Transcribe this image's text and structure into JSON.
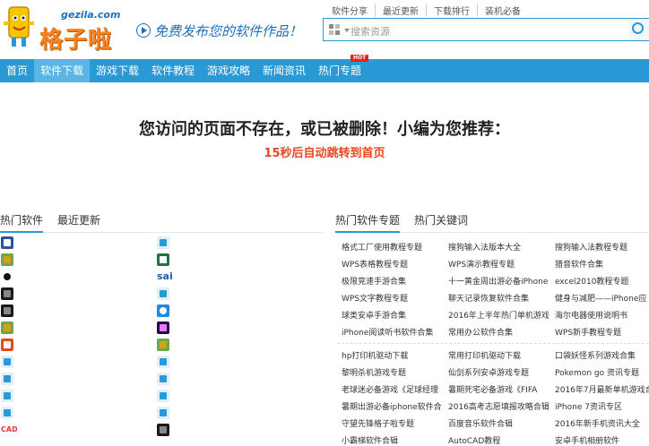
{
  "header": {
    "site_url": "gezila.com",
    "brand": "格子啦",
    "slogan": "免费发布您的软件作品！",
    "top_links": [
      "软件分享",
      "最近更新",
      "下载排行",
      "装机必备"
    ],
    "search_placeholder": "搜索资源"
  },
  "nav": {
    "items": [
      "首页",
      "软件下载",
      "游戏下载",
      "软件教程",
      "游戏攻略",
      "新闻资讯",
      "热门专题"
    ],
    "active_index": 1,
    "hot_badge": "HOT"
  },
  "notice": {
    "message": "您访问的页面不存在，或已被删除！小编为您推荐：",
    "redirect": "15秒后自动跳转到首页"
  },
  "left_panel": {
    "tabs": [
      "热门软件",
      "最近更新"
    ],
    "active_tab": 0,
    "left_column_icons": [
      "word-icon",
      "game-icon",
      "qq-icon",
      "film-icon",
      "film-icon",
      "game-icon",
      "office-icon",
      "app-icon",
      "app-icon",
      "app-icon",
      "app-icon",
      "cad-icon"
    ],
    "right_column_icons": [
      "app-icon",
      "excel-icon",
      "sai-icon",
      "app-icon",
      "refresh-icon",
      "premiere-icon",
      "game-icon",
      "app-icon",
      "app-icon",
      "app-icon",
      "app-icon",
      "film-icon"
    ],
    "sai_label": "sai",
    "cad_label": "CAD"
  },
  "right_panel": {
    "tabs": [
      "热门软件专题",
      "热门关键词"
    ],
    "active_tab": 0,
    "topics": [
      [
        "格式工厂使用教程专题",
        "搜狗输入法版本大全",
        "搜狗输入法教程专题"
      ],
      [
        "WPS表格教程专题",
        "WPS演示教程专题",
        "猎音软件合集"
      ],
      [
        "极限竞速手游合集",
        "十一黄金周出游必备iPhone",
        "excel2010教程专题"
      ],
      [
        "WPS文字教程专题",
        "聊天记录恢复软件合集",
        "健身与减肥——iPhone应"
      ],
      [
        "球类安卓手游合集",
        "2016年上半年热门单机游戏",
        "海尔电器使用说明书"
      ],
      [
        "iPhone阅读听书软件合集",
        "常用办公软件合集",
        "WPS新手教程专题"
      ]
    ],
    "keywords": [
      [
        "hp打印机驱动下载",
        "常用打印机驱动下载",
        "口袋妖怪系列游戏合集"
      ],
      [
        "黎明杀机游戏专题",
        "仙剑系列安卓游戏专题",
        "Pokemon go 资讯专题"
      ],
      [
        "老球迷必备游戏《足球经理",
        "暑期死宅必备游戏《FIFA",
        "2016年7月最新单机游戏合"
      ],
      [
        "暑期出游必备iphone软件合",
        "2016高考志愿填报攻略合辑",
        "iPhone 7资讯专区"
      ],
      [
        "守望先锋格子啦专题",
        "百度音乐软件合辑",
        "2016年新手机资讯大全"
      ],
      [
        "小霸梯软件合辑",
        "AutoCAD教程",
        "安卓手机相册软件"
      ]
    ]
  },
  "colors": {
    "nav_blue": "#2a9ad6",
    "nav_active": "#5ab4e6",
    "brand_orange": "#f58220",
    "redirect_red": "#e8471e",
    "hot_red": "#e8221e"
  }
}
